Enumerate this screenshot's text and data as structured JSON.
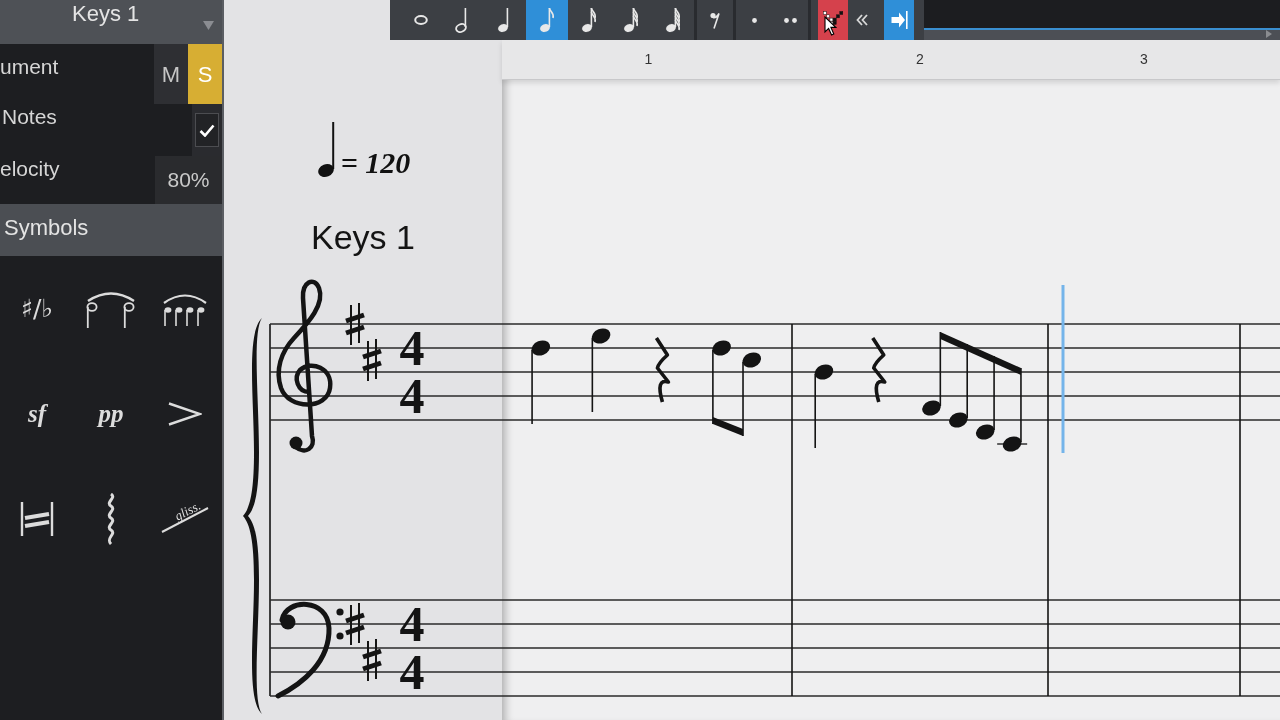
{
  "inspector": {
    "title": "Keys 1",
    "rows": [
      {
        "kind": "mute_solo",
        "label": "ument",
        "buttons": [
          {
            "label": "M",
            "on": false
          },
          {
            "label": "S",
            "on": true
          }
        ]
      },
      {
        "kind": "checkbox",
        "label": "Notes",
        "checked": true
      },
      {
        "kind": "value",
        "label": "elocity",
        "value": "80%"
      }
    ]
  },
  "symbols": {
    "title": "Symbols",
    "items": [
      {
        "kind": "accidentals",
        "label": "♯/♭"
      },
      {
        "kind": "tie"
      },
      {
        "kind": "slur"
      },
      {
        "kind": "dynamic",
        "label": "sf"
      },
      {
        "kind": "dynamic",
        "label": "pp"
      },
      {
        "kind": "accent"
      },
      {
        "kind": "tremolo"
      },
      {
        "kind": "arpeggio"
      },
      {
        "kind": "glissando",
        "label": "gliss."
      }
    ]
  },
  "toolbar": {
    "buttons": [
      {
        "kind": "whole",
        "selected": false
      },
      {
        "kind": "half",
        "selected": false
      },
      {
        "kind": "quarter",
        "selected": false
      },
      {
        "kind": "eighth",
        "selected": true
      },
      {
        "kind": "sixteenth",
        "selected": false
      },
      {
        "kind": "thirty_second",
        "selected": false
      },
      {
        "kind": "sixty_fourth",
        "selected": false
      },
      {
        "kind": "eighth_rest",
        "selected": false
      },
      {
        "kind": "dot",
        "selected": false
      },
      {
        "kind": "double_dot",
        "selected": false
      },
      {
        "kind": "pattern",
        "selected": true
      },
      {
        "kind": "back",
        "selected": false
      },
      {
        "kind": "step",
        "selected": true
      }
    ]
  },
  "ruler": [
    "1",
    "2",
    "3"
  ],
  "score": {
    "tempo": "= 120",
    "title": "Keys 1",
    "staves": [
      {
        "kind": "treble",
        "key_signature": [
          {
            "kind": "sharp"
          },
          {
            "kind": "sharp"
          }
        ],
        "time": [
          "4",
          "4"
        ]
      },
      {
        "kind": "bass",
        "key_signature": [
          {
            "kind": "sharp"
          },
          {
            "kind": "sharp"
          }
        ],
        "time": [
          "4",
          "4"
        ]
      }
    ],
    "measures": [
      {
        "events": [
          {
            "kind": "quarter"
          },
          {
            "kind": "quarter"
          },
          {
            "kind": "quarter_rest"
          },
          {
            "kind": "eighth"
          },
          {
            "kind": "eighth"
          }
        ]
      },
      {
        "events": [
          {
            "kind": "quarter"
          },
          {
            "kind": "quarter_rest"
          },
          {
            "kind": "eighth"
          },
          {
            "kind": "eighth"
          },
          {
            "kind": "eighth"
          },
          {
            "kind": "eighth"
          }
        ]
      },
      {
        "events": [
          {
            "kind": "cursor"
          }
        ]
      }
    ]
  }
}
